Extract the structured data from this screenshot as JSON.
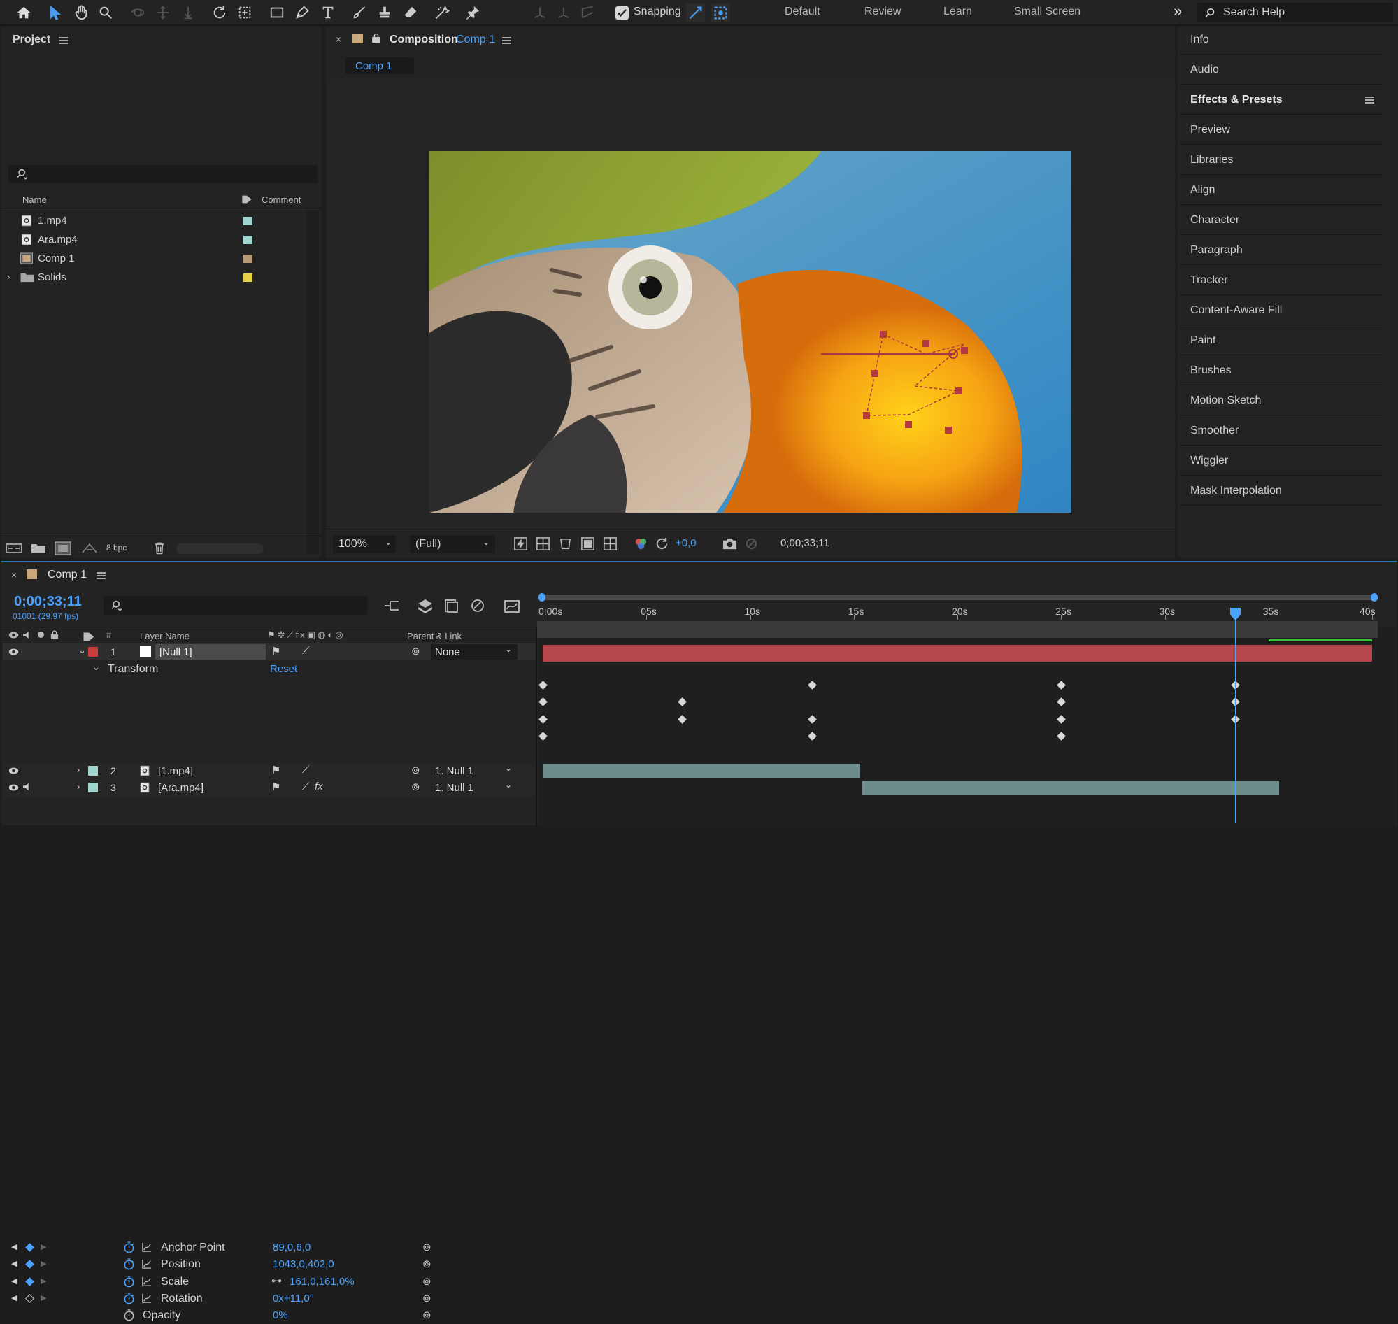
{
  "toolbar": {
    "snapping_label": "Snapping",
    "workspaces": [
      "Default",
      "Review",
      "Learn",
      "Small Screen"
    ],
    "more_glyph": "»",
    "search_placeholder": "Search Help",
    "accent_color": "#4b9cf0"
  },
  "project": {
    "title": "Project",
    "columns": {
      "name": "Name",
      "comment": "Comment"
    },
    "items": [
      {
        "name": "1.mp4",
        "icon": "footage-icon",
        "label_color": "#9fd4cf"
      },
      {
        "name": "Ara.mp4",
        "icon": "footage-icon",
        "label_color": "#9fd4cf"
      },
      {
        "name": "Comp 1",
        "icon": "composition-icon",
        "label_color": "#b69a77"
      },
      {
        "name": "Solids",
        "icon": "folder-icon",
        "label_color": "#e6d34a"
      }
    ],
    "bpc_label": "8 bpc"
  },
  "composition": {
    "panel_label": "Composition",
    "comp_name": "Comp 1",
    "tab_label": "Comp 1",
    "zoom": "100%",
    "resolution": "(Full)",
    "exposure": "+0,0",
    "current_time": "0;00;33;11"
  },
  "right_panel": {
    "items": [
      "Info",
      "Audio",
      "Effects & Presets",
      "Preview",
      "Libraries",
      "Align",
      "Character",
      "Paragraph",
      "Tracker",
      "Content-Aware Fill",
      "Paint",
      "Brushes",
      "Motion Sketch",
      "Smoother",
      "Wiggler",
      "Mask Interpolation"
    ],
    "bold_item": "Effects & Presets"
  },
  "timeline": {
    "tab_label": "Comp 1",
    "timecode": "0;00;33;11",
    "frame_info": "01001 (29.97 fps)",
    "ruler_ticks": [
      "0:00s",
      "05s",
      "10s",
      "15s",
      "20s",
      "25s",
      "30s",
      "35s",
      "40s"
    ],
    "current_time_seconds": 33.4,
    "headers": {
      "layer_name": "Layer Name",
      "number": "#",
      "parent": "Parent & Link"
    },
    "layers": [
      {
        "index": "1",
        "name": "[Null 1]",
        "label_color": "#c83c3c",
        "parent": "None",
        "bar_color": "#b5464c",
        "start": 0,
        "end": 40
      },
      {
        "index": "2",
        "name": "[1.mp4]",
        "label_color": "#9fd4cf",
        "parent": "1. Null 1",
        "bar_color": "#6e8c8b",
        "start": 0,
        "end": 15.3
      },
      {
        "index": "3",
        "name": "[Ara.mp4]",
        "label_color": "#9fd4cf",
        "parent": "1. Null 1",
        "bar_color": "#6e8c8b",
        "start": 15.4,
        "end": 35.5
      }
    ],
    "transform": {
      "label": "Transform",
      "reset_label": "Reset",
      "properties": [
        {
          "name": "Anchor Point",
          "value": "89,0,6,0",
          "keyframes": [
            0,
            13,
            25,
            33.4
          ]
        },
        {
          "name": "Position",
          "value": "1043,0,402,0",
          "keyframes": [
            0,
            6.7,
            25,
            33.4
          ]
        },
        {
          "name": "Scale",
          "value": "161,0,161,0%",
          "keyframes": [
            0,
            6.7,
            13,
            25,
            33.4
          ]
        },
        {
          "name": "Rotation",
          "value": "0x+11,0°",
          "keyframes": [
            0,
            13,
            25
          ]
        },
        {
          "name": "Opacity",
          "value": "0%",
          "keyframes": []
        }
      ]
    }
  }
}
